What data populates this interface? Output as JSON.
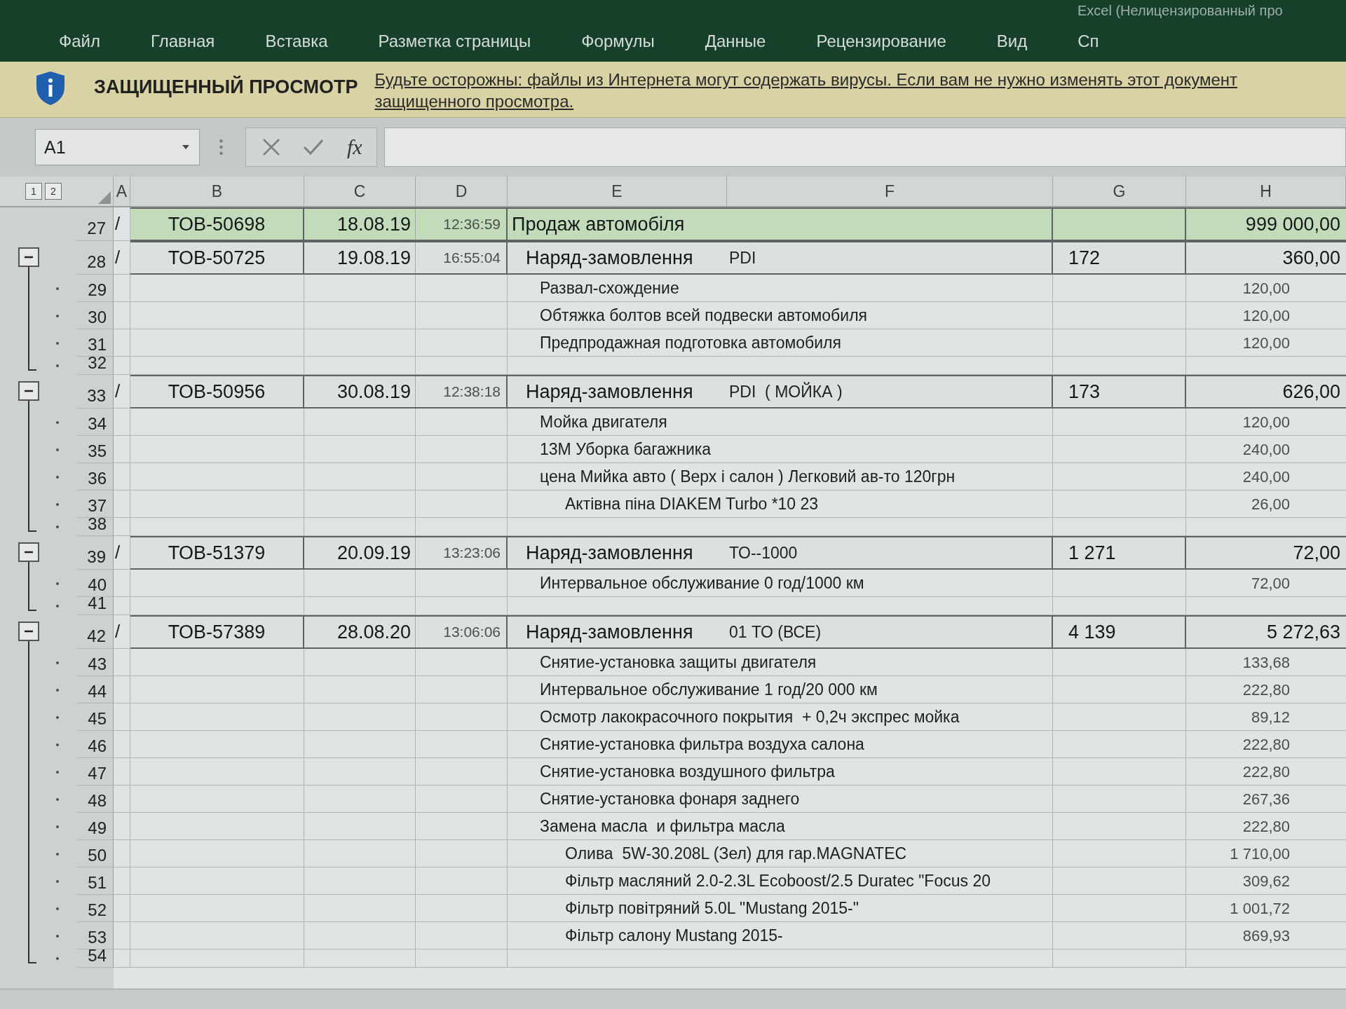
{
  "title_bar": {
    "title": "Excel (Нелицензированный про"
  },
  "ribbon": {
    "tabs": [
      {
        "label": "Файл"
      },
      {
        "label": "Главная"
      },
      {
        "label": "Вставка"
      },
      {
        "label": "Разметка страницы"
      },
      {
        "label": "Формулы"
      },
      {
        "label": "Данные"
      },
      {
        "label": "Рецензирование"
      },
      {
        "label": "Вид"
      },
      {
        "label": "Сп"
      }
    ]
  },
  "protected_view": {
    "title": "ЗАЩИЩЕННЫЙ ПРОСМОТР",
    "message_lines": [
      "Будьте осторожны: файлы из Интернета могут содержать вирусы. Если вам не нужно изменять этот документ",
      "защищенного просмотра."
    ]
  },
  "formula_bar": {
    "name_box": "A1",
    "function_label": "fx"
  },
  "sheet": {
    "outline_levels": [
      "1",
      "2"
    ],
    "columns": [
      "A",
      "B",
      "C",
      "D",
      "E",
      "F",
      "G",
      "H"
    ],
    "rows": [
      {
        "kind": "sale",
        "number": "27",
        "col_a": "/",
        "document": "ТОВ-50698",
        "date": "18.08.19",
        "time": "12:36:59",
        "title": "Продаж автомобіля",
        "amount": "999 000,00"
      },
      {
        "kind": "order",
        "number": "28",
        "expanded": true,
        "col_a": "/",
        "document": "ТОВ-50725",
        "date": "19.08.19",
        "time": "16:55:04",
        "title": "Наряд-замовлення",
        "detail": "PDI",
        "code": "172",
        "amount": "360,00",
        "children": [
          {
            "kind": "item",
            "number": "29",
            "text": "Развал-схождение",
            "amount": "120,00"
          },
          {
            "kind": "item",
            "number": "30",
            "text": "Обтяжка болтов всей подвески автомобиля",
            "amount": "120,00"
          },
          {
            "kind": "item",
            "number": "31",
            "text": "Предпродажная подготовка автомобиля",
            "amount": "120,00"
          },
          {
            "kind": "blank",
            "number": "32"
          }
        ]
      },
      {
        "kind": "order",
        "number": "33",
        "expanded": true,
        "col_a": "/",
        "document": "ТОВ-50956",
        "date": "30.08.19",
        "time": "12:38:18",
        "title": "Наряд-замовлення",
        "detail": "PDI  ( МОЙКА )",
        "code": "173",
        "amount": "626,00",
        "children": [
          {
            "kind": "item",
            "number": "34",
            "text": "Мойка двигателя",
            "amount": "120,00"
          },
          {
            "kind": "item",
            "number": "35",
            "text": "13М Уборка багажника",
            "amount": "240,00"
          },
          {
            "kind": "item",
            "number": "36",
            "text": "цена Мийка авто ( Верх і салон ) Легковий ав-то 120грн",
            "amount": "240,00"
          },
          {
            "kind": "subitem",
            "number": "37",
            "text": "Актівна піна DIAKEM Turbo *10 23",
            "amount": "26,00"
          },
          {
            "kind": "blank",
            "number": "38"
          }
        ]
      },
      {
        "kind": "order",
        "number": "39",
        "expanded": true,
        "col_a": "/",
        "document": "ТОВ-51379",
        "date": "20.09.19",
        "time": "13:23:06",
        "title": "Наряд-замовлення",
        "detail": "ТО--1000",
        "code": "1 271",
        "amount": "72,00",
        "children": [
          {
            "kind": "item",
            "number": "40",
            "text": "Интервальное обслуживание 0 год/1000 км",
            "amount": "72,00"
          },
          {
            "kind": "blank",
            "number": "41"
          }
        ]
      },
      {
        "kind": "order",
        "number": "42",
        "expanded": true,
        "col_a": "/",
        "document": "ТОВ-57389",
        "date": "28.08.20",
        "time": "13:06:06",
        "title": "Наряд-замовлення",
        "detail": "01 ТО (ВСЕ)",
        "code": "4 139",
        "amount": "5 272,63",
        "children": [
          {
            "kind": "item",
            "number": "43",
            "text": "Снятие-установка защиты двигателя",
            "amount": "133,68"
          },
          {
            "kind": "item",
            "number": "44",
            "text": "Интервальное обслуживание 1 год/20 000 км",
            "amount": "222,80"
          },
          {
            "kind": "item",
            "number": "45",
            "text": "Осмотр лакокрасочного покрытия  + 0,2ч экспрес мойка",
            "amount": "89,12"
          },
          {
            "kind": "item",
            "number": "46",
            "text": "Снятие-установка фильтра воздуха салона",
            "amount": "222,80"
          },
          {
            "kind": "item",
            "number": "47",
            "text": "Снятие-установка воздушного фильтра",
            "amount": "222,80"
          },
          {
            "kind": "item",
            "number": "48",
            "text": "Снятие-установка фонаря заднего",
            "amount": "267,36"
          },
          {
            "kind": "item",
            "number": "49",
            "text": "Замена масла  и фильтра масла",
            "amount": "222,80"
          },
          {
            "kind": "subitem",
            "number": "50",
            "text": "Олива  5W-30.208L (Зел) для гар.MAGNATEC",
            "amount": "1 710,00"
          },
          {
            "kind": "subitem",
            "number": "51",
            "text": "Фільтр масляний 2.0-2.3L Ecoboost/2.5 Duratec \"Focus 20",
            "amount": "309,62"
          },
          {
            "kind": "subitem",
            "number": "52",
            "text": "Фільтр повітряний 5.0L \"Mustang 2015-\"",
            "amount": "1 001,72"
          },
          {
            "kind": "subitem",
            "number": "53",
            "text": "Фільтр салону Mustang 2015-",
            "amount": "869,93"
          },
          {
            "kind": "blank",
            "number": "54"
          }
        ]
      }
    ]
  }
}
